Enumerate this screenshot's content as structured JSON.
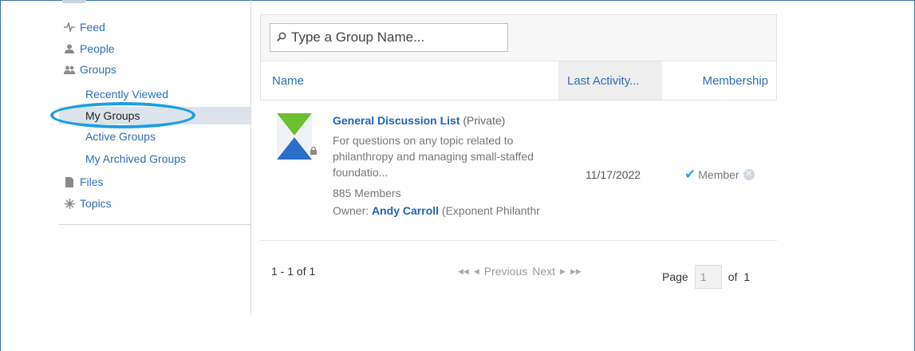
{
  "sidebar": {
    "items": [
      {
        "label": "Feed",
        "icon": "pulse-icon"
      },
      {
        "label": "People",
        "icon": "person-icon"
      },
      {
        "label": "Groups",
        "icon": "group-icon"
      }
    ],
    "group_subitems": [
      {
        "label": "Recently Viewed"
      },
      {
        "label": "My Groups",
        "active": true
      },
      {
        "label": "Active Groups"
      },
      {
        "label": "My Archived Groups"
      }
    ],
    "bottom_items": [
      {
        "label": "Files",
        "icon": "file-icon"
      },
      {
        "label": "Topics",
        "icon": "topics-icon"
      }
    ]
  },
  "search": {
    "placeholder": "Type a Group Name..."
  },
  "table": {
    "headers": {
      "name": "Name",
      "last_activity": "Last Activity...",
      "membership": "Membership"
    },
    "rows": [
      {
        "title": "General Discussion List",
        "visibility": "(Private)",
        "description": "For questions on any topic related to philanthropy and managing small-staffed foundatio...",
        "members": "885 Members",
        "owner_label": "Owner:",
        "owner_name": "Andy Carroll",
        "owner_org": "(Exponent Philanthr",
        "last_activity": "11/17/2022",
        "membership": "Member"
      }
    ]
  },
  "pagination": {
    "count": "1 - 1 of 1",
    "previous": "Previous",
    "next": "Next",
    "page_label": "Page",
    "page_value": "1",
    "of_label": "of",
    "total_pages": "1"
  },
  "colors": {
    "link": "#2f6eb5",
    "highlight_ring": "#1a9fe0",
    "logo_green": "#6cbf2f",
    "logo_blue": "#2a6fc9"
  }
}
